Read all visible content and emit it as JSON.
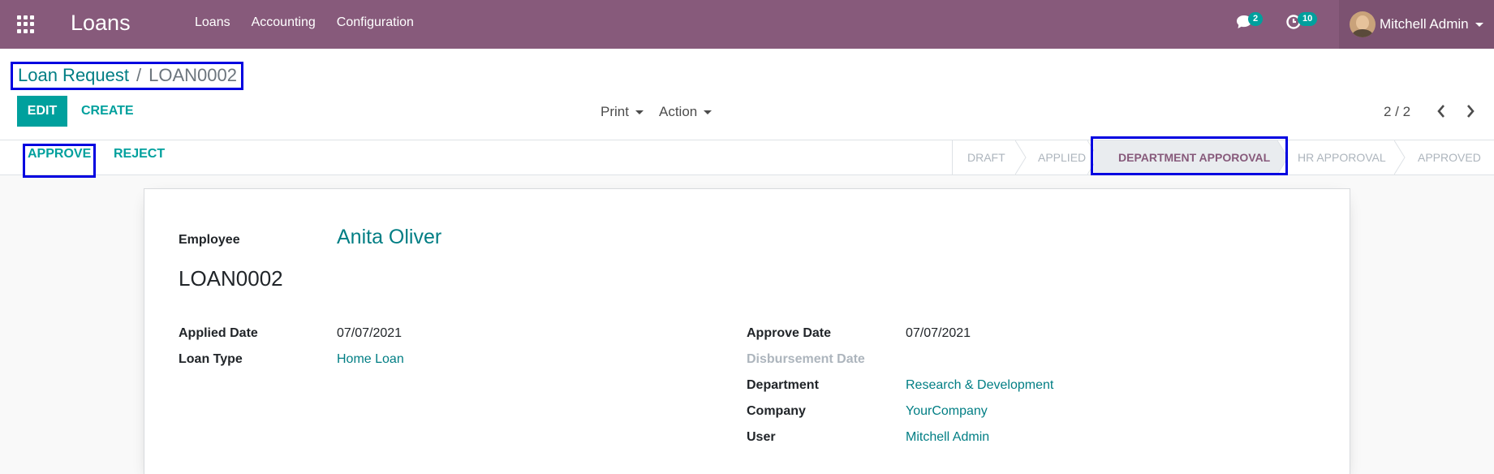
{
  "app": {
    "title": "Loans"
  },
  "navbar": {
    "menu": [
      "Loans",
      "Accounting",
      "Configuration"
    ],
    "messages_count": "2",
    "activities_count": "10",
    "user_name": "Mitchell Admin",
    "icons": {
      "apps": "apps-grid-icon",
      "messages": "chat-icon",
      "activities": "clock-icon"
    }
  },
  "breadcrumb": {
    "parent": "Loan Request",
    "separator": "/",
    "current": "LOAN0002"
  },
  "toolbar": {
    "edit_label": "EDIT",
    "create_label": "CREATE",
    "print_label": "Print",
    "action_label": "Action"
  },
  "pager": {
    "value": "2 / 2"
  },
  "statusbar": {
    "buttons": {
      "approve": "APPROVE",
      "reject": "REJECT"
    },
    "stages": [
      "DRAFT",
      "APPLIED",
      "DEPARTMENT APPOROVAL",
      "HR APPOROVAL",
      "APPROVED"
    ],
    "active_stage": "DEPARTMENT APPOROVAL"
  },
  "form": {
    "employee_label": "Employee",
    "employee_value": "Anita Oliver",
    "record_name": "LOAN0002",
    "left": [
      {
        "label": "Applied Date",
        "value": "07/07/2021"
      },
      {
        "label": "Loan Type",
        "value": "Home Loan"
      }
    ],
    "right": [
      {
        "label": "Approve Date",
        "value": "07/07/2021"
      },
      {
        "label": "Disbursement Date",
        "value": ""
      },
      {
        "label": "Department",
        "value": "Research & Development"
      },
      {
        "label": "Company",
        "value": "YourCompany"
      },
      {
        "label": "User",
        "value": "Mitchell Admin"
      }
    ]
  },
  "colors": {
    "navbar": "#875a7b",
    "primary": "#00a09d",
    "link": "#017e84",
    "highlight_box": "#0000e0"
  }
}
